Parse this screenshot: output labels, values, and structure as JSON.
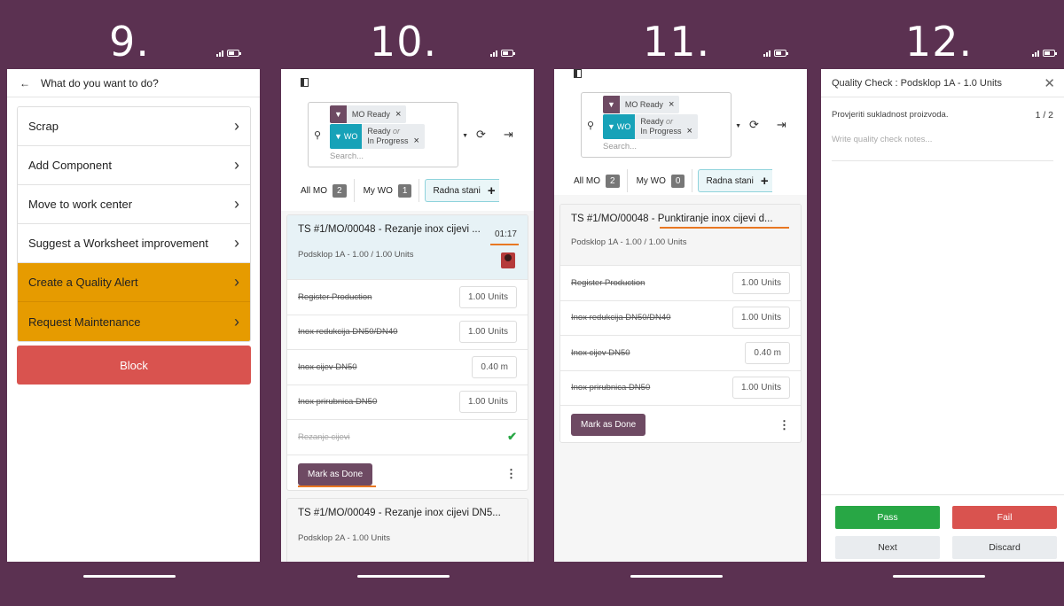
{
  "steps": [
    "9.",
    "10.",
    "11.",
    "12."
  ],
  "screen9": {
    "title": "What do you want to do?",
    "items": [
      "Scrap",
      "Add Component",
      "Move to work center",
      "Suggest a Worksheet improvement",
      "Create a Quality Alert",
      "Request Maintenance"
    ],
    "block_label": "Block"
  },
  "screen10": {
    "facet1": {
      "value": "MO Ready"
    },
    "facet2": {
      "label": "WO",
      "value1": "Ready",
      "or": "or",
      "value2": "In Progress"
    },
    "search_placeholder": "Search...",
    "tabs": {
      "all_mo": "All MO",
      "all_mo_count": "2",
      "my_wo": "My WO",
      "my_wo_count": "1",
      "work_center": "Radna stani"
    },
    "card1": {
      "title": "TS #1/MO/00048 - Rezanje inox cijevi ...",
      "timer": "01:17",
      "subtitle": "Podsklop 1A - 1.00 / 1.00 Units",
      "rows": [
        {
          "name": "Register Production",
          "qty": "1.00 Units"
        },
        {
          "name": "Inox redukcija DN50/DN40",
          "qty": "1.00 Units"
        },
        {
          "name": "Inox cijev DN50",
          "qty": "0.40 m"
        },
        {
          "name": "Inox prirubnica DN50",
          "qty": "1.00 Units"
        }
      ],
      "done_step": "Rezanje cijevi",
      "mark_done": "Mark as Done"
    },
    "card2": {
      "title": "TS #1/MO/00049 - Rezanje inox cijevi DN5...",
      "subtitle": "Podsklop 2A - 1.00 Units"
    }
  },
  "screen11": {
    "facet1": {
      "value": "MO Ready"
    },
    "facet2": {
      "label": "WO",
      "value1": "Ready",
      "or": "or",
      "value2": "In Progress"
    },
    "search_placeholder": "Search...",
    "tabs": {
      "all_mo": "All MO",
      "all_mo_count": "2",
      "my_wo": "My WO",
      "my_wo_count": "0",
      "work_center": "Radna stani"
    },
    "card": {
      "title_prefix": "TS #1/MO/00048 - ",
      "title_rest": "Punktiranje inox cijevi d...",
      "subtitle": "Podsklop 1A - 1.00 / 1.00 Units",
      "rows": [
        {
          "name": "Register Production",
          "qty": "1.00 Units"
        },
        {
          "name": "Inox redukcija DN50/DN40",
          "qty": "1.00 Units"
        },
        {
          "name": "Inox cijev DN50",
          "qty": "0.40 m"
        },
        {
          "name": "Inox prirubnica DN50",
          "qty": "1.00 Units"
        }
      ],
      "mark_done": "Mark as Done"
    }
  },
  "screen12": {
    "title": "Quality Check : Podsklop 1A - 1.0 Units",
    "instruction": "Provjeriti sukladnost proizvoda.",
    "progress": "1 / 2",
    "notes_placeholder": "Write quality check notes...",
    "pass": "Pass",
    "fail": "Fail",
    "next": "Next",
    "discard": "Discard"
  },
  "colors": {
    "frame": "#5b3151",
    "accent": "#6e4a63",
    "warn": "#e69b00",
    "danger": "#d9534f",
    "success": "#28a745",
    "teal": "#17a2b8",
    "highlight": "#e87722"
  }
}
